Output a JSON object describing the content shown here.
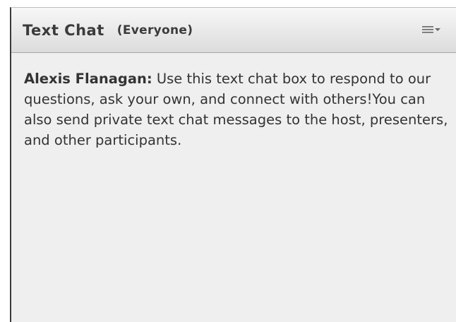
{
  "pod": {
    "title": "Text Chat",
    "subtitle": "(Everyone)",
    "menu_icon": "pod-options-menu-icon"
  },
  "messages": [
    {
      "sender": "Alexis Flanagan:",
      "text": " Use this text chat box to respond to our questions, ask your own, and connect with others!You can also send private text chat messages to the host, presenters, and other participants."
    }
  ],
  "colors": {
    "header_top": "#f7f7f7",
    "header_bottom": "#dcdcdc",
    "body_background": "#efefef",
    "text": "#333333"
  }
}
